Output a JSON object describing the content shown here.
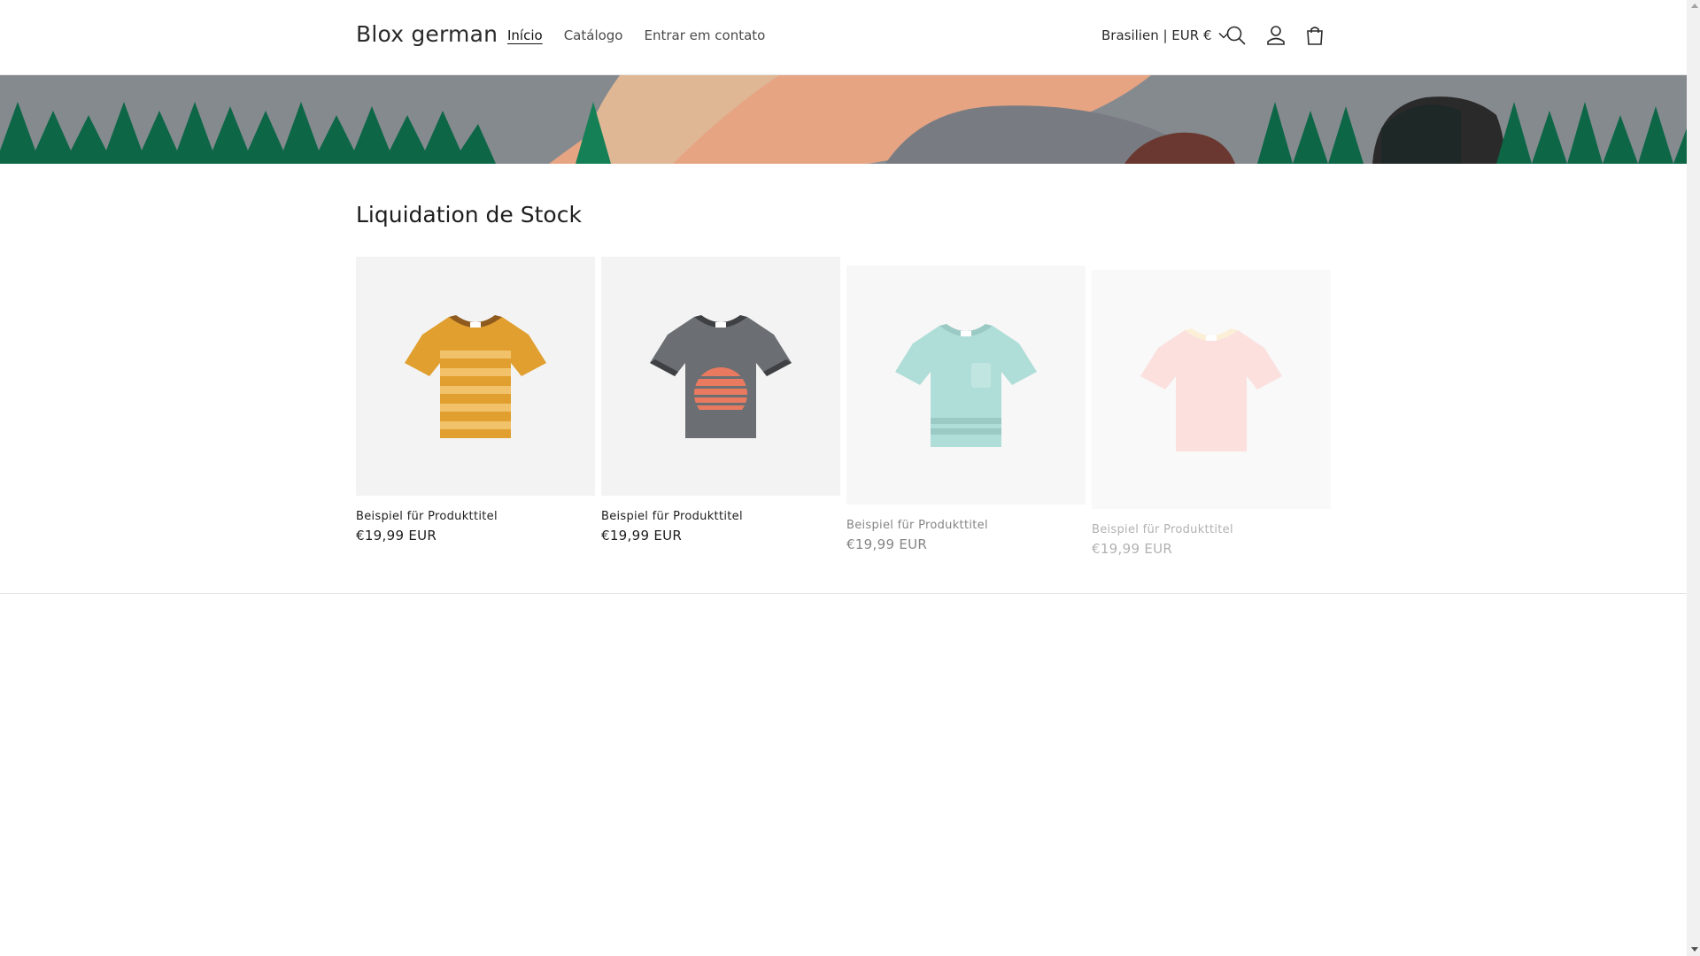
{
  "header": {
    "brand": "Blox german",
    "nav": [
      {
        "label": "Início"
      },
      {
        "label": "Catálogo"
      },
      {
        "label": "Entrar em contato"
      }
    ],
    "country_selector": "Brasilien | EUR €",
    "icons": [
      "search-icon",
      "account-icon",
      "cart-icon"
    ]
  },
  "collection": {
    "title": "Liquidation de Stock",
    "products": [
      {
        "title": "Beispiel für Produkttitel",
        "price": "€19,99 EUR",
        "image": "shirt-orange-striped"
      },
      {
        "title": "Beispiel für Produkttitel",
        "price": "€19,99 EUR",
        "image": "shirt-grey-sunset"
      },
      {
        "title": "Beispiel für Produkttitel",
        "price": "€19,99 EUR",
        "image": "shirt-teal-pocket"
      },
      {
        "title": "Beispiel für Produkttitel",
        "price": "€19,99 EUR",
        "image": "shirt-pink-plain"
      }
    ]
  },
  "colors": {
    "banner_green": "#0e6b4a",
    "banner_grey": "#8a8f94",
    "banner_peach": "#eeaa88",
    "shirt_orange": "#e09f2e",
    "shirt_grey": "#6b6e72",
    "shirt_teal": "#8fd1c8",
    "shirt_pink": "#f4c1bd"
  }
}
